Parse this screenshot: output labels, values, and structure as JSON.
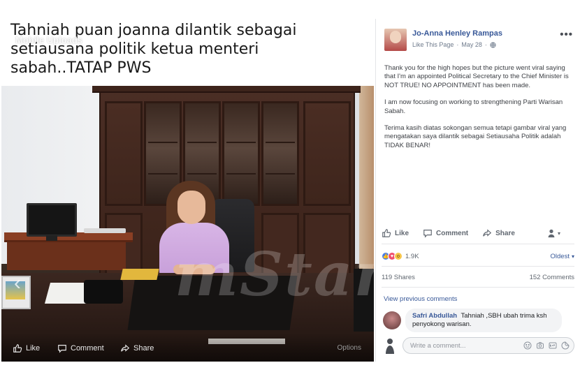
{
  "photo": {
    "caption": "Tahniah puan joanna dilantik sebagai setiausana politik ketua menteri sabah..TATAP PWS",
    "upload_source": "Mobile Uploads",
    "watermark": "mStar",
    "nav_arrow_icon": "chevron-left-icon",
    "actions": {
      "like_label": "Like",
      "comment_label": "Comment",
      "share_label": "Share",
      "options_label": "Options"
    }
  },
  "post": {
    "author": "Jo-Anna Henley Rampas",
    "like_page_label": "Like This Page",
    "date": "May 28",
    "paragraphs": [
      "Thank you for the high hopes but the picture went viral saying that I'm an appointed Political Secretary to the Chief Minister is NOT TRUE! NO APPOINTMENT has been made.",
      "I am now focusing on working to strengthening Parti Warisan Sabah.",
      "Terima kasih diatas sokongan semua tetapi gambar viral yang mengatakan saya dilantik sebagai Setiausaha Politik adalah TIDAK BENAR!"
    ],
    "actions": {
      "like_label": "Like",
      "comment_label": "Comment",
      "share_label": "Share"
    },
    "reactions_count": "1.9K",
    "sort_label": "Oldest",
    "shares": "119 Shares",
    "comments_count": "152 Comments",
    "view_previous_label": "View previous comments"
  },
  "comments": [
    {
      "author": "Safri Abdullah",
      "text": "Tahniah ,SBH ubah trima ksh penyokong warisan."
    }
  ],
  "composer": {
    "placeholder": "Write a comment..."
  },
  "colors": {
    "link_blue": "#385898",
    "like_blue": "#4a7fe8",
    "love_red": "#f0506e",
    "wow_yellow": "#f7c64a",
    "blouse_lilac": "#d8b5e6"
  }
}
